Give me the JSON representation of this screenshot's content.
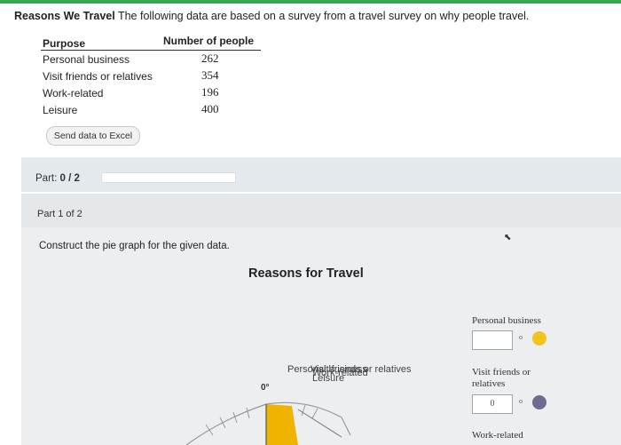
{
  "intro": {
    "title": "Reasons We Travel",
    "text": "The following data are based on a survey from a travel survey on why people travel."
  },
  "table": {
    "headers": [
      "Purpose",
      "Number of people"
    ],
    "rows": [
      {
        "purpose": "Personal business",
        "count": "262"
      },
      {
        "purpose": "Visit friends or relatives",
        "count": "354"
      },
      {
        "purpose": "Work-related",
        "count": "196"
      },
      {
        "purpose": "Leisure",
        "count": "400"
      }
    ]
  },
  "excel_button": "Send data to Excel",
  "part_progress": {
    "label": "Part:",
    "value": "0 / 2",
    "fraction": 0.0
  },
  "part_section": {
    "header": "Part 1 of 2",
    "instruction": "Construct the pie graph for the given data."
  },
  "chart": {
    "title": "Reasons for Travel",
    "degree_label": "0°",
    "stacked_labels": [
      "Personal business",
      "Visit friends or relatives",
      "Work-related",
      "Leisure"
    ],
    "legend": [
      {
        "label": "Personal business",
        "value": "",
        "unit": "o",
        "color": "#f0c419"
      },
      {
        "label": "Visit friends or relatives",
        "value": "0",
        "unit": "o",
        "color": "#6e6c8e"
      },
      {
        "label": "Work-related",
        "value": "",
        "unit": "o",
        "color": "#888888"
      }
    ],
    "slice_color": "#f0b400"
  }
}
